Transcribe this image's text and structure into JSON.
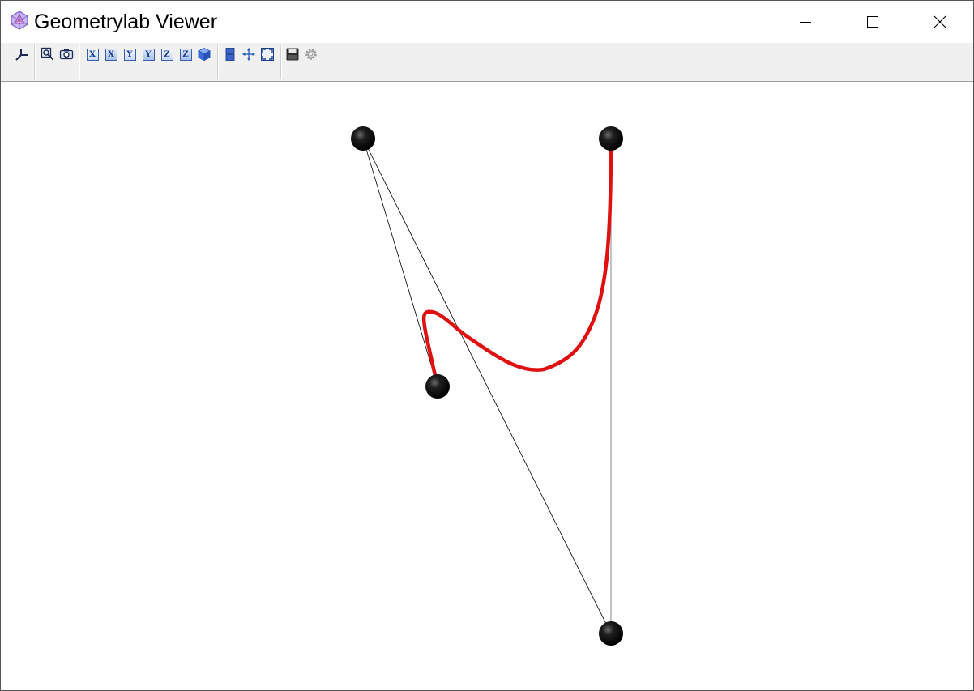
{
  "window": {
    "title": "Geometrylab Viewer",
    "controls": [
      "minimize",
      "maximize",
      "close"
    ]
  },
  "toolbar": {
    "buttons": [
      {
        "name": "axes-tool",
        "icon": "axes-icon"
      },
      {
        "name": "zoom-window",
        "icon": "zoom-icon"
      },
      {
        "name": "screenshot",
        "icon": "camera-icon"
      },
      {
        "name": "view-x-pos",
        "label": "X"
      },
      {
        "name": "view-x-neg",
        "label": "X"
      },
      {
        "name": "view-y-pos",
        "label": "Y"
      },
      {
        "name": "view-y-neg",
        "label": "Y"
      },
      {
        "name": "view-z-pos",
        "label": "Z"
      },
      {
        "name": "view-z-neg",
        "label": "Z"
      },
      {
        "name": "view-iso",
        "icon": "cube-icon"
      },
      {
        "name": "layout",
        "icon": "split-view-icon"
      },
      {
        "name": "center",
        "icon": "pan-icon"
      },
      {
        "name": "fit-all",
        "icon": "fit-icon"
      },
      {
        "name": "save",
        "icon": "save-icon"
      },
      {
        "name": "settings",
        "icon": "gear-icon"
      }
    ]
  },
  "scene": {
    "control_points": 4,
    "curve_color": "#e01010",
    "point_color": "#000000",
    "polygon_color": "#000000",
    "segment_color": "#999999"
  }
}
